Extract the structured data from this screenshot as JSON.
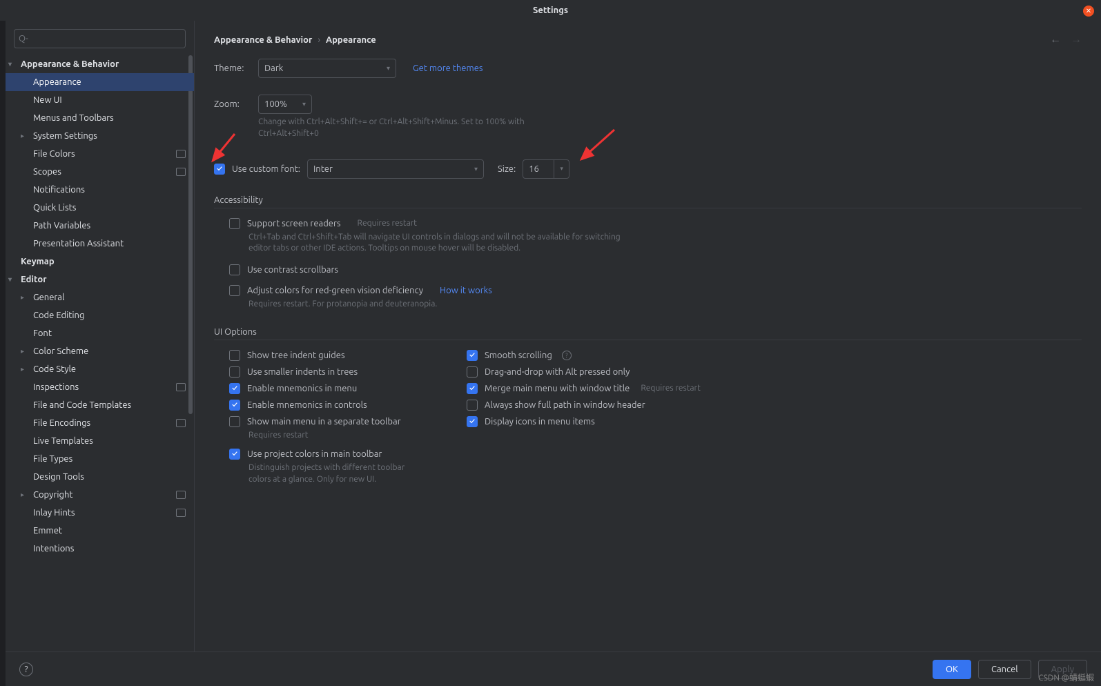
{
  "title": "Settings",
  "search_placeholder": "",
  "sidebar": {
    "items": [
      {
        "label": "Appearance & Behavior",
        "bold": true,
        "chev": "down",
        "lvl": 0
      },
      {
        "label": "Appearance",
        "lvl": 1,
        "selected": true
      },
      {
        "label": "New UI",
        "lvl": 1
      },
      {
        "label": "Menus and Toolbars",
        "lvl": 1
      },
      {
        "label": "System Settings",
        "lvl": 1,
        "chev": "right"
      },
      {
        "label": "File Colors",
        "lvl": 1,
        "badge": true
      },
      {
        "label": "Scopes",
        "lvl": 1,
        "badge": true
      },
      {
        "label": "Notifications",
        "lvl": 1
      },
      {
        "label": "Quick Lists",
        "lvl": 1
      },
      {
        "label": "Path Variables",
        "lvl": 1
      },
      {
        "label": "Presentation Assistant",
        "lvl": 1
      },
      {
        "label": "Keymap",
        "bold": true,
        "lvl": 0
      },
      {
        "label": "Editor",
        "bold": true,
        "chev": "down",
        "lvl": 0
      },
      {
        "label": "General",
        "lvl": 1,
        "chev": "right"
      },
      {
        "label": "Code Editing",
        "lvl": 1
      },
      {
        "label": "Font",
        "lvl": 1
      },
      {
        "label": "Color Scheme",
        "lvl": 1,
        "chev": "right"
      },
      {
        "label": "Code Style",
        "lvl": 1,
        "chev": "right"
      },
      {
        "label": "Inspections",
        "lvl": 1,
        "badge": true
      },
      {
        "label": "File and Code Templates",
        "lvl": 1
      },
      {
        "label": "File Encodings",
        "lvl": 1,
        "badge": true
      },
      {
        "label": "Live Templates",
        "lvl": 1
      },
      {
        "label": "File Types",
        "lvl": 1
      },
      {
        "label": "Design Tools",
        "lvl": 1
      },
      {
        "label": "Copyright",
        "lvl": 1,
        "chev": "right",
        "badge": true
      },
      {
        "label": "Inlay Hints",
        "lvl": 1,
        "badge": true
      },
      {
        "label": "Emmet",
        "lvl": 1
      },
      {
        "label": "Intentions",
        "lvl": 1
      }
    ]
  },
  "breadcrumb": {
    "parent": "Appearance & Behavior",
    "sep": "›",
    "current": "Appearance"
  },
  "theme": {
    "label": "Theme:",
    "value": "Dark",
    "link": "Get more themes"
  },
  "zoom": {
    "label": "Zoom:",
    "value": "100%",
    "hint": "Change with Ctrl+Alt+Shift+= or Ctrl+Alt+Shift+Minus. Set to 100% with Ctrl+Alt+Shift+0"
  },
  "custom_font": {
    "label": "Use custom font:",
    "value": "Inter",
    "size_label": "Size:",
    "size_value": "16"
  },
  "accessibility": {
    "title": "Accessibility",
    "screen_readers": {
      "label": "Support screen readers",
      "hint": "Requires restart",
      "desc": "Ctrl+Tab and Ctrl+Shift+Tab will navigate UI controls in dialogs and will not be available for switching editor tabs or other IDE actions. Tooltips on mouse hover will be disabled."
    },
    "contrast": {
      "label": "Use contrast scrollbars"
    },
    "color_def": {
      "label": "Adjust colors for red-green vision deficiency",
      "link": "How it works",
      "desc": "Requires restart. For protanopia and deuteranopia."
    }
  },
  "ui_options": {
    "title": "UI Options",
    "left": [
      {
        "label": "Show tree indent guides",
        "checked": false
      },
      {
        "label": "Use smaller indents in trees",
        "checked": false
      },
      {
        "label": "Enable mnemonics in menu",
        "checked": true
      },
      {
        "label": "Enable mnemonics in controls",
        "checked": true
      },
      {
        "label": "Show main menu in a separate toolbar",
        "checked": false,
        "sub": "Requires restart"
      },
      {
        "label": "Use project colors in main toolbar",
        "checked": true,
        "sub": "Distinguish projects with different toolbar colors at a glance. Only for new UI."
      }
    ],
    "right": [
      {
        "label": "Smooth scrolling",
        "checked": true,
        "help": true
      },
      {
        "label": "Drag-and-drop with Alt pressed only",
        "checked": false
      },
      {
        "label": "Merge main menu with window title",
        "checked": true,
        "inline_hint": "Requires restart"
      },
      {
        "label": "Always show full path in window header",
        "checked": false
      },
      {
        "label": "Display icons in menu items",
        "checked": true
      }
    ]
  },
  "footer": {
    "ok": "OK",
    "cancel": "Cancel",
    "apply": "Apply"
  },
  "watermark": "CSDN @蜻蜓蝦"
}
